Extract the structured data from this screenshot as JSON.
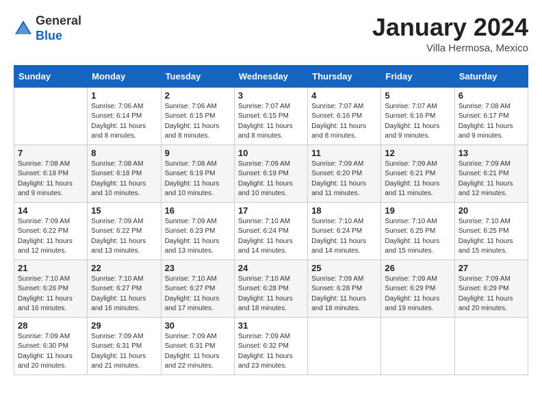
{
  "header": {
    "logo_general": "General",
    "logo_blue": "Blue",
    "title": "January 2024",
    "subtitle": "Villa Hermosa, Mexico"
  },
  "weekdays": [
    "Sunday",
    "Monday",
    "Tuesday",
    "Wednesday",
    "Thursday",
    "Friday",
    "Saturday"
  ],
  "weeks": [
    [
      {
        "day": "",
        "detail": ""
      },
      {
        "day": "1",
        "detail": "Sunrise: 7:06 AM\nSunset: 6:14 PM\nDaylight: 11 hours\nand 8 minutes."
      },
      {
        "day": "2",
        "detail": "Sunrise: 7:06 AM\nSunset: 6:15 PM\nDaylight: 11 hours\nand 8 minutes."
      },
      {
        "day": "3",
        "detail": "Sunrise: 7:07 AM\nSunset: 6:15 PM\nDaylight: 11 hours\nand 8 minutes."
      },
      {
        "day": "4",
        "detail": "Sunrise: 7:07 AM\nSunset: 6:16 PM\nDaylight: 11 hours\nand 8 minutes."
      },
      {
        "day": "5",
        "detail": "Sunrise: 7:07 AM\nSunset: 6:16 PM\nDaylight: 11 hours\nand 9 minutes."
      },
      {
        "day": "6",
        "detail": "Sunrise: 7:08 AM\nSunset: 6:17 PM\nDaylight: 11 hours\nand 9 minutes."
      }
    ],
    [
      {
        "day": "7",
        "detail": "Sunrise: 7:08 AM\nSunset: 6:18 PM\nDaylight: 11 hours\nand 9 minutes."
      },
      {
        "day": "8",
        "detail": "Sunrise: 7:08 AM\nSunset: 6:18 PM\nDaylight: 11 hours\nand 10 minutes."
      },
      {
        "day": "9",
        "detail": "Sunrise: 7:08 AM\nSunset: 6:19 PM\nDaylight: 11 hours\nand 10 minutes."
      },
      {
        "day": "10",
        "detail": "Sunrise: 7:09 AM\nSunset: 6:19 PM\nDaylight: 11 hours\nand 10 minutes."
      },
      {
        "day": "11",
        "detail": "Sunrise: 7:09 AM\nSunset: 6:20 PM\nDaylight: 11 hours\nand 11 minutes."
      },
      {
        "day": "12",
        "detail": "Sunrise: 7:09 AM\nSunset: 6:21 PM\nDaylight: 11 hours\nand 11 minutes."
      },
      {
        "day": "13",
        "detail": "Sunrise: 7:09 AM\nSunset: 6:21 PM\nDaylight: 11 hours\nand 12 minutes."
      }
    ],
    [
      {
        "day": "14",
        "detail": "Sunrise: 7:09 AM\nSunset: 6:22 PM\nDaylight: 11 hours\nand 12 minutes."
      },
      {
        "day": "15",
        "detail": "Sunrise: 7:09 AM\nSunset: 6:22 PM\nDaylight: 11 hours\nand 13 minutes."
      },
      {
        "day": "16",
        "detail": "Sunrise: 7:09 AM\nSunset: 6:23 PM\nDaylight: 11 hours\nand 13 minutes."
      },
      {
        "day": "17",
        "detail": "Sunrise: 7:10 AM\nSunset: 6:24 PM\nDaylight: 11 hours\nand 14 minutes."
      },
      {
        "day": "18",
        "detail": "Sunrise: 7:10 AM\nSunset: 6:24 PM\nDaylight: 11 hours\nand 14 minutes."
      },
      {
        "day": "19",
        "detail": "Sunrise: 7:10 AM\nSunset: 6:25 PM\nDaylight: 11 hours\nand 15 minutes."
      },
      {
        "day": "20",
        "detail": "Sunrise: 7:10 AM\nSunset: 6:25 PM\nDaylight: 11 hours\nand 15 minutes."
      }
    ],
    [
      {
        "day": "21",
        "detail": "Sunrise: 7:10 AM\nSunset: 6:26 PM\nDaylight: 11 hours\nand 16 minutes."
      },
      {
        "day": "22",
        "detail": "Sunrise: 7:10 AM\nSunset: 6:27 PM\nDaylight: 11 hours\nand 16 minutes."
      },
      {
        "day": "23",
        "detail": "Sunrise: 7:10 AM\nSunset: 6:27 PM\nDaylight: 11 hours\nand 17 minutes."
      },
      {
        "day": "24",
        "detail": "Sunrise: 7:10 AM\nSunset: 6:28 PM\nDaylight: 11 hours\nand 18 minutes."
      },
      {
        "day": "25",
        "detail": "Sunrise: 7:09 AM\nSunset: 6:28 PM\nDaylight: 11 hours\nand 18 minutes."
      },
      {
        "day": "26",
        "detail": "Sunrise: 7:09 AM\nSunset: 6:29 PM\nDaylight: 11 hours\nand 19 minutes."
      },
      {
        "day": "27",
        "detail": "Sunrise: 7:09 AM\nSunset: 6:29 PM\nDaylight: 11 hours\nand 20 minutes."
      }
    ],
    [
      {
        "day": "28",
        "detail": "Sunrise: 7:09 AM\nSunset: 6:30 PM\nDaylight: 11 hours\nand 20 minutes."
      },
      {
        "day": "29",
        "detail": "Sunrise: 7:09 AM\nSunset: 6:31 PM\nDaylight: 11 hours\nand 21 minutes."
      },
      {
        "day": "30",
        "detail": "Sunrise: 7:09 AM\nSunset: 6:31 PM\nDaylight: 11 hours\nand 22 minutes."
      },
      {
        "day": "31",
        "detail": "Sunrise: 7:09 AM\nSunset: 6:32 PM\nDaylight: 11 hours\nand 23 minutes."
      },
      {
        "day": "",
        "detail": ""
      },
      {
        "day": "",
        "detail": ""
      },
      {
        "day": "",
        "detail": ""
      }
    ]
  ]
}
